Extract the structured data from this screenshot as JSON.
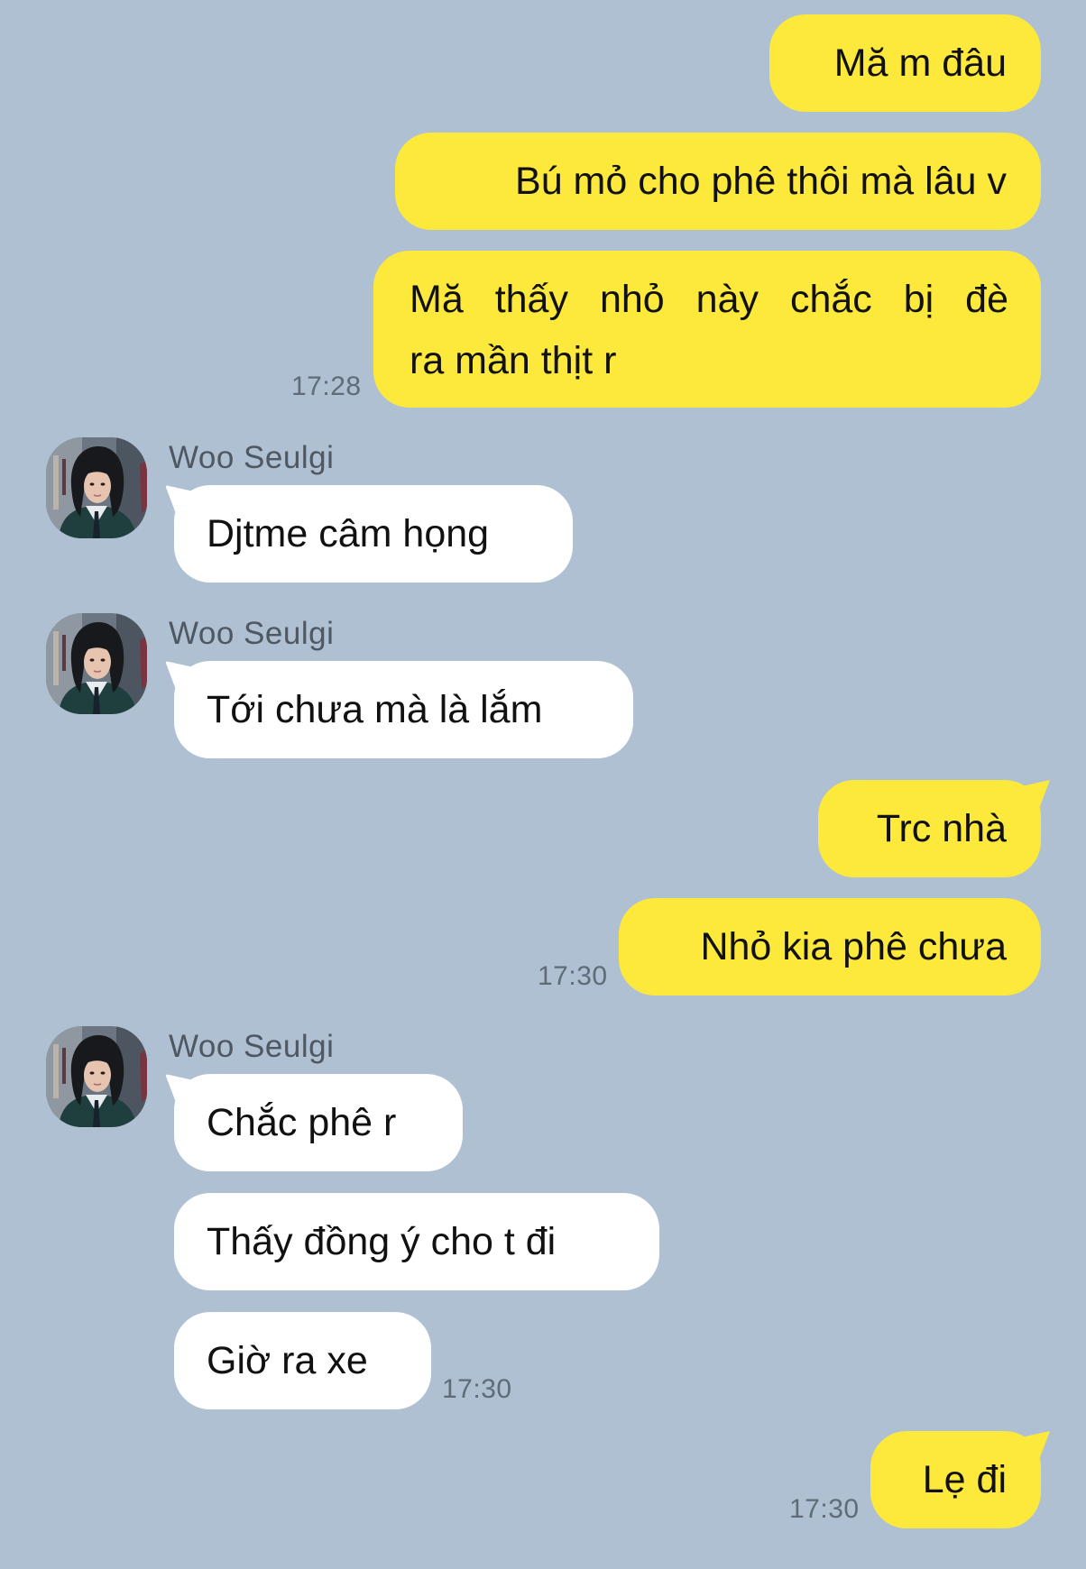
{
  "contact": {
    "name": "Woo Seulgi"
  },
  "colors": {
    "background": "#aec0d2",
    "outgoing_bubble": "#fde83c",
    "incoming_bubble": "#ffffff"
  },
  "messages": [
    {
      "dir": "out",
      "text": "Mă m đâu"
    },
    {
      "dir": "out",
      "text": "Bú mỏ cho phê thôi mà lâu v"
    },
    {
      "dir": "out",
      "lines": [
        "Mă thấy nhỏ này chắc bị đè",
        "ra mần thịt r"
      ],
      "time": "17:28"
    },
    {
      "dir": "in",
      "sender": "Woo Seulgi",
      "text": "Djtme câm họng"
    },
    {
      "dir": "in",
      "sender": "Woo Seulgi",
      "text": "Tới chưa mà là lắm"
    },
    {
      "dir": "out",
      "text": "Trc nhà"
    },
    {
      "dir": "out",
      "text": "Nhỏ kia phê chưa",
      "time": "17:30"
    },
    {
      "dir": "in",
      "sender": "Woo Seulgi",
      "text": "Chắc phê r"
    },
    {
      "dir": "in",
      "text": "Thấy đồng ý cho t đi"
    },
    {
      "dir": "in",
      "text": "Giờ ra xe",
      "time": "17:30"
    },
    {
      "dir": "out",
      "text": "Lẹ đi",
      "time": "17:30"
    }
  ]
}
